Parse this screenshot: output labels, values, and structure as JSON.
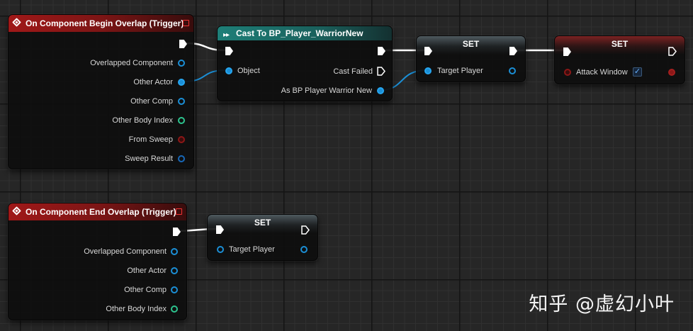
{
  "begin_overlap_node": {
    "title": "On Component Begin Overlap (Trigger)",
    "pins": [
      "Overlapped Component",
      "Other Actor",
      "Other Comp",
      "Other Body Index",
      "From Sweep",
      "Sweep Result"
    ]
  },
  "cast_node": {
    "title": "Cast To BP_Player_WarriorNew",
    "object_pin": "Object",
    "cast_failed_pin": "Cast Failed",
    "as_pin": "As BP Player Warrior New"
  },
  "set_target_node": {
    "title": "SET",
    "pin": "Target Player"
  },
  "set_attack_node": {
    "title": "SET",
    "pin": "Attack Window",
    "checked": true
  },
  "end_overlap_node": {
    "title": "On Component End Overlap (Trigger)",
    "pins": [
      "Overlapped Component",
      "Other Actor",
      "Other Comp",
      "Other Body Index"
    ]
  },
  "set_target_node_2": {
    "title": "SET",
    "pin": "Target Player"
  },
  "watermark": "知乎 @虚幻小叶",
  "colors": {
    "object_pin": "#1b8fd6",
    "int_pin": "#2dc38e",
    "bool_pin": "#8c1717",
    "event_header": "#a01818",
    "cast_header": "#1e7f78"
  }
}
